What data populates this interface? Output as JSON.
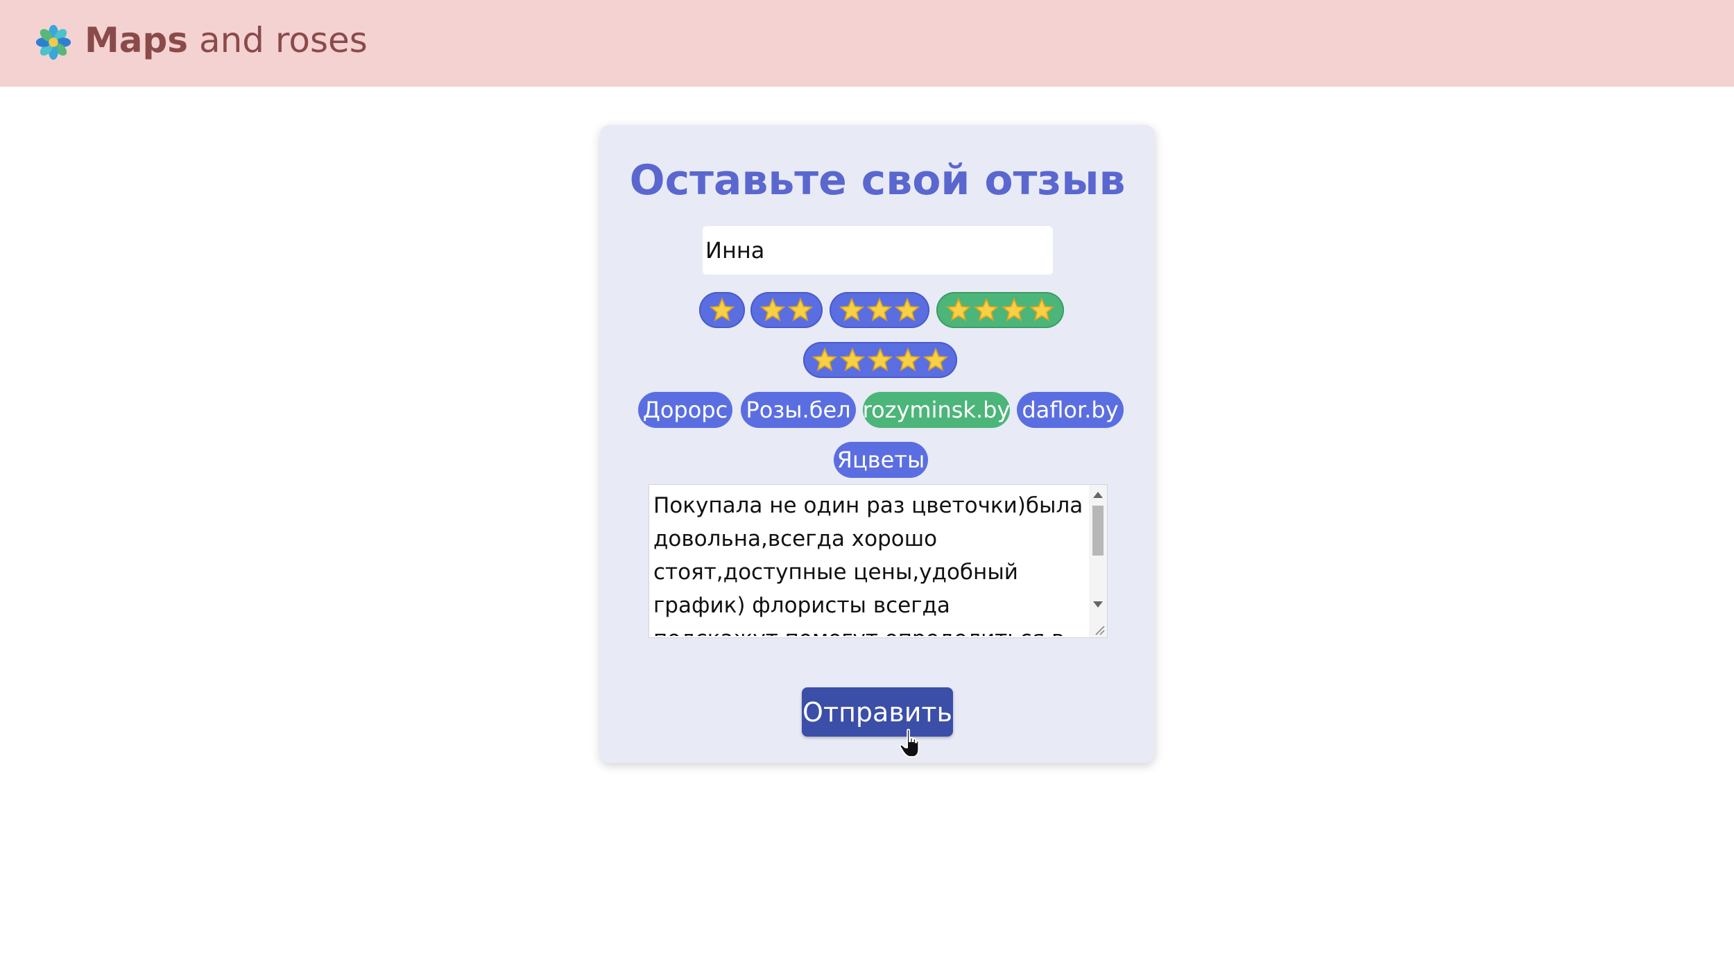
{
  "header": {
    "brand_bold": "Maps",
    "brand_rest": " and roses",
    "background": "#f4d2d2",
    "brand_color": "#8b4a4a",
    "logo_icon": "flower-icon"
  },
  "form": {
    "title": "Оставьте свой отзыв",
    "title_color": "#5a67cf",
    "name_value": "Инна",
    "ratings": [
      {
        "label": "1 star",
        "stars": 1,
        "selected": false
      },
      {
        "label": "2 stars",
        "stars": 2,
        "selected": false
      },
      {
        "label": "3 stars",
        "stars": 3,
        "selected": false
      },
      {
        "label": "4 stars",
        "stars": 4,
        "selected": true
      },
      {
        "label": "5 stars",
        "stars": 5,
        "selected": false
      }
    ],
    "shops": [
      {
        "label": "Дорорс",
        "selected": false
      },
      {
        "label": "Розы.бел",
        "selected": false
      },
      {
        "label": "rozyminsk.by",
        "selected": true
      },
      {
        "label": "daflor.by",
        "selected": false
      },
      {
        "label": "Яцветы",
        "selected": false
      }
    ],
    "review_text": "Покупала не один раз цветочки)была довольна,всегда хорошо стоят,доступные цены,удобный график) флористы всегда подскажут,помогут определиться в выборе по",
    "submit_label": "Отправить",
    "pill_color": "#5b6ee1",
    "selected_color": "#4cb57a",
    "button_color": "#3b4ea8"
  }
}
